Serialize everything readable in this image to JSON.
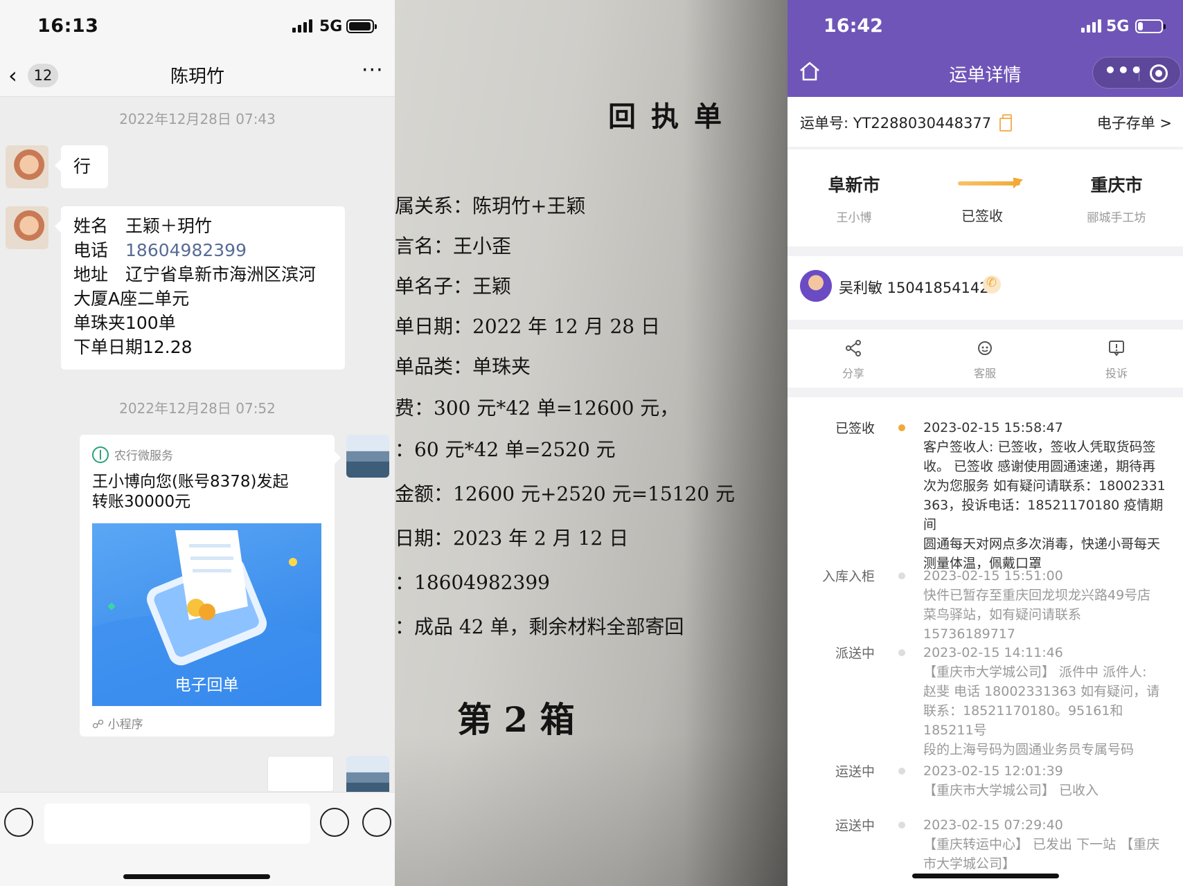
{
  "chat": {
    "status_time": "16:13",
    "network": "5G",
    "unread_count": "12",
    "contact_name": "陈玥竹",
    "timestamp_1": "2022年12月28日 07:43",
    "msg_ok": "行",
    "order_lines": [
      "姓名　王颖＋玥竹",
      "地址　辽宁省阜新市海洲区滨河",
      "大厦A座二单元",
      "单珠夹100单",
      "下单日期12.28"
    ],
    "phone_label": "电话　",
    "phone_number": "18604982399",
    "timestamp_2": "2022年12月28日 07:52",
    "transfer_card": {
      "source": "农行微服务",
      "text_line1": "王小博向您(账号8378)发起",
      "text_line2": "转账30000元",
      "image_caption": "电子回单",
      "footer": "小程序"
    }
  },
  "receipt": {
    "title": "回执单",
    "lines": [
      "属关系：陈玥竹+王颖",
      "言名：王小歪",
      "单名子：王颖",
      "单日期：2022 年 12 月 28 日",
      "单品类：单珠夹",
      "费：300 元*42 单=12600 元，",
      "：60 元*42 单=2520 元",
      "金额：12600 元+2520 元=15120 元",
      "日期：2023 年 2 月 12 日",
      "：18604982399",
      "：成品 42 单，剩余材料全部寄回"
    ],
    "box_label": "第 2 箱"
  },
  "tracking": {
    "status_time": "16:42",
    "network": "5G",
    "page_title": "运单详情",
    "waybill_label": "运单号: YT2288030448377",
    "e_storage": "电子存单 >",
    "origin_city": "阜新市",
    "origin_person": "王小博",
    "route_status": "已签收",
    "dest_city": "重庆市",
    "dest_person": "郦城手工坊",
    "courier": "吴利敏 15041854142",
    "actions": [
      "分享",
      "客服",
      "投诉"
    ],
    "events": [
      {
        "tag": "已签收",
        "lines": [
          "2023-02-15 15:58:47",
          "客户签收人: 已签收，签收人凭取货码签",
          "收。 已签收 感谢使用圆通速递，期待再",
          "次为您服务 如有疑问请联系：18002331",
          "363，投诉电话：18521170180 疫情期间",
          "圆通每天对网点多次消毒，快递小哥每天",
          "测量体温，佩戴口罩"
        ]
      },
      {
        "tag": "入库入柜",
        "lines": [
          "2023-02-15 15:51:00",
          "快件已暂存至重庆回龙坝龙兴路49号店",
          "菜鸟驿站，如有疑问请联系15736189717"
        ]
      },
      {
        "tag": "派送中",
        "lines": [
          "2023-02-15 14:11:46",
          "【重庆市大学城公司】 派件中 派件人:",
          "赵斐 电话 18002331363 如有疑问，请",
          "联系：18521170180。95161和185211号",
          "段的上海号码为圆通业务员专属号码"
        ]
      },
      {
        "tag": "运送中",
        "lines": [
          "2023-02-15 12:01:39",
          "【重庆市大学城公司】 已收入"
        ]
      },
      {
        "tag": "运送中",
        "lines": [
          "2023-02-15 07:29:40",
          "【重庆转运中心】 已发出 下一站 【重庆",
          "市大学城公司】"
        ]
      }
    ]
  },
  "colors": {
    "wechat_bg": "#ededed",
    "link": "#576b95",
    "yto_purple": "#6f55b8",
    "yto_orange": "#f2a937"
  }
}
